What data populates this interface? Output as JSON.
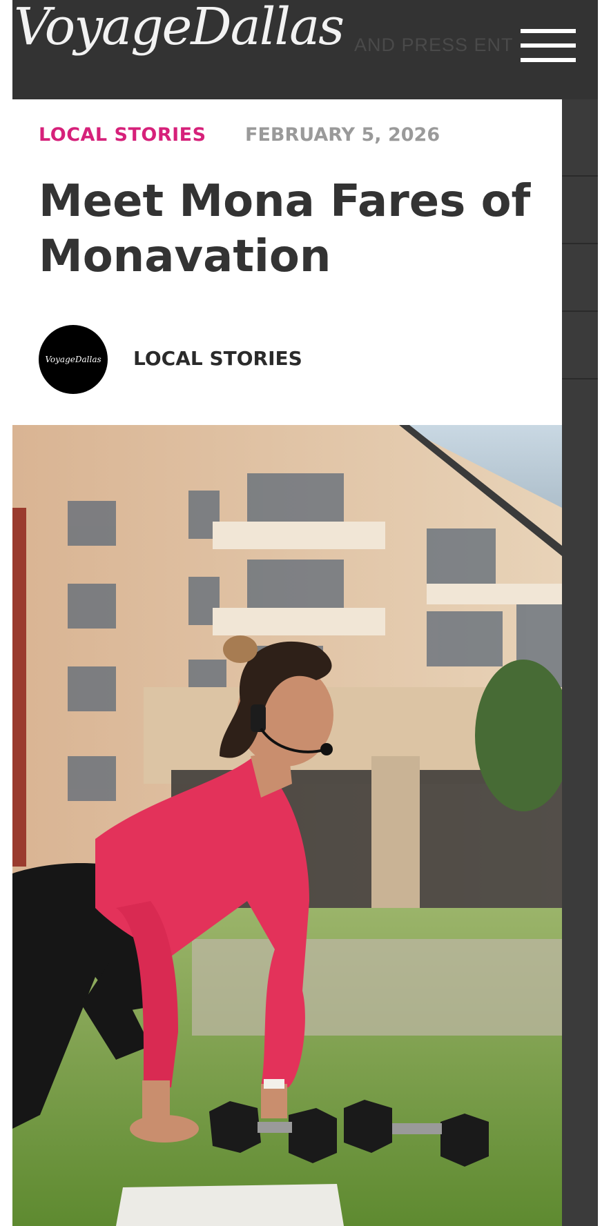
{
  "header": {
    "logo": "VoyageDallas",
    "ticker_text": "AND PRESS ENT"
  },
  "article": {
    "category": "LOCAL STORIES",
    "date": "FEBRUARY 5, 2026",
    "title": "Meet Mona Fares of Monavation",
    "author_logo_text": "VoyageDallas",
    "author_category": "LOCAL STORIES"
  },
  "colors": {
    "header_bg": "#333333",
    "category_accent": "#d6217a",
    "date_gray": "#9a9a9a",
    "title_text": "#333333"
  },
  "icons": {
    "menu": "hamburger-menu-icon"
  }
}
